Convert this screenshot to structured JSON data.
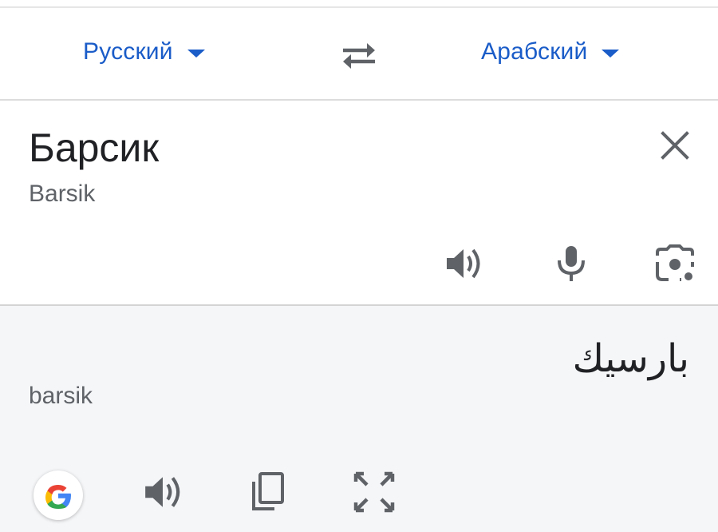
{
  "languages": {
    "source": "Русский",
    "target": "Арабский"
  },
  "source": {
    "text": "Барсик",
    "transliteration": "Barsik"
  },
  "target": {
    "text": "بارسيك",
    "transliteration": "barsik"
  },
  "icons": {
    "swap": "swap-languages-icon",
    "clear": "close-icon",
    "listen_source": "speaker-icon",
    "mic": "microphone-icon",
    "camera": "camera-lens-icon",
    "google": "google-logo-icon",
    "listen_target": "speaker-icon",
    "copy": "copy-icon",
    "fullscreen": "fullscreen-icon"
  },
  "colors": {
    "accent": "#1a5cc8",
    "icon": "#5f6368",
    "target_bg": "#f5f6f8"
  }
}
